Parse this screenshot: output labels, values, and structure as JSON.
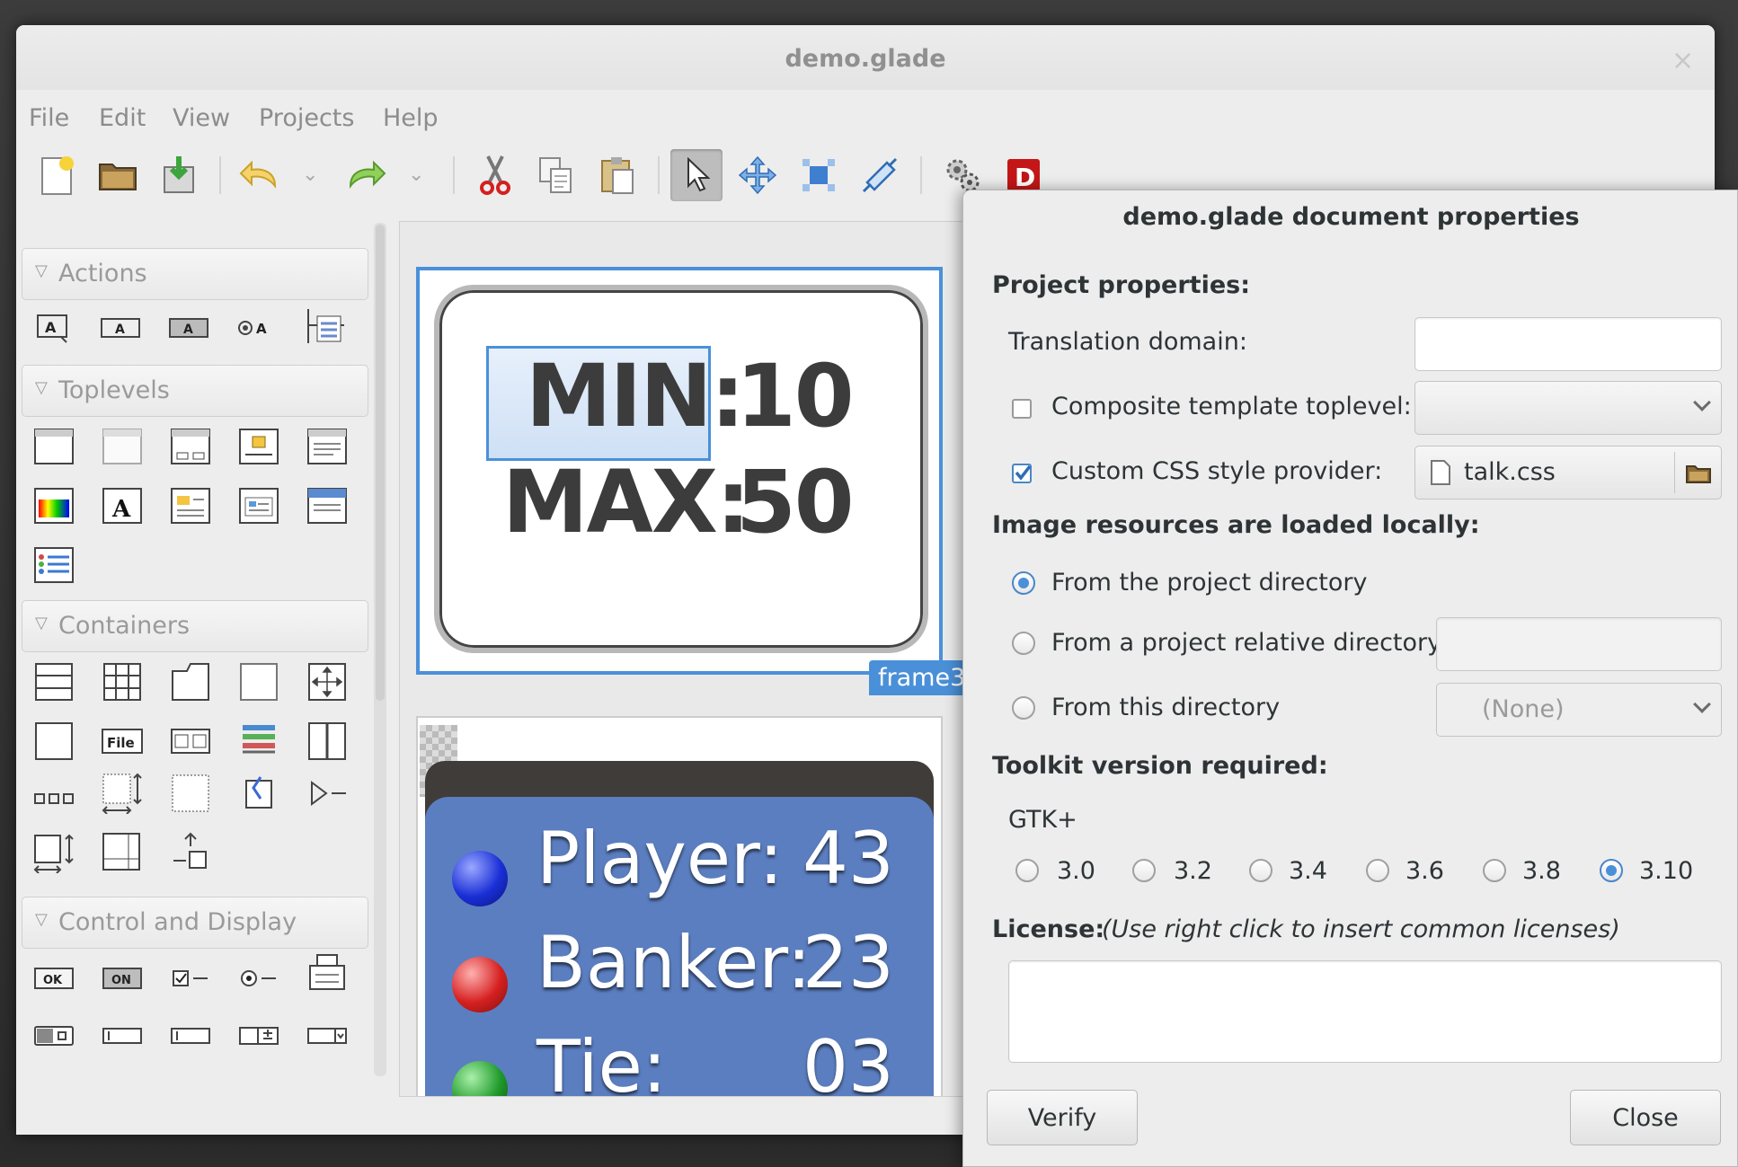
{
  "window": {
    "title": "demo.glade",
    "close_glyph": "×"
  },
  "menubar": [
    "File",
    "Edit",
    "View",
    "Projects",
    "Help"
  ],
  "toolbar": {
    "icons": [
      "new-file-icon",
      "open-folder-icon",
      "save-icon",
      "undo-icon",
      "redo-icon",
      "cut-icon",
      "copy-icon",
      "paste-icon",
      "select-pointer-icon",
      "drag-resize-icon",
      "margin-edit-icon",
      "alignment-edit-icon",
      "preferences-gears-icon",
      "devhelp-icon"
    ]
  },
  "palette": {
    "groups": [
      {
        "label": "Actions"
      },
      {
        "label": "Toplevels"
      },
      {
        "label": "Containers"
      },
      {
        "label": "Control and Display"
      }
    ],
    "glyphs": {
      "ok": "OK",
      "on": "ON",
      "file": "File",
      "a": "A"
    }
  },
  "canvas": {
    "frame3": {
      "min_label": "MIN:",
      "min_value": "10",
      "max_label": "MAX:",
      "max_value": "50",
      "tag": "frame3"
    },
    "scoreboard": [
      {
        "label": "Player:",
        "value": "43",
        "color": "#1a2fd6"
      },
      {
        "label": "Banker:",
        "value": "23",
        "color": "#d62020"
      },
      {
        "label": "Tie:",
        "value": "03",
        "color": "#1f9a2a"
      }
    ]
  },
  "dialog": {
    "title": "demo.glade document properties",
    "project_properties": "Project properties:",
    "translation_domain_label": "Translation domain:",
    "translation_domain_value": "",
    "composite_label": "Composite template toplevel:",
    "composite_checked": false,
    "css_label": "Custom CSS style provider:",
    "css_checked": true,
    "css_file": "talk.css",
    "image_resources_heading": "Image resources are loaded locally:",
    "radio_project_dir": "From the project directory",
    "radio_relative_dir": "From a project relative directory",
    "radio_this_dir": "From this directory",
    "this_dir_value": "(None)",
    "toolkit_heading": "Toolkit version required:",
    "toolkit_name": "GTK+",
    "versions": [
      "3.0",
      "3.2",
      "3.4",
      "3.6",
      "3.8",
      "3.10"
    ],
    "selected_version": "3.10",
    "license_label": "License:",
    "license_hint": "(Use right click to insert common licenses)",
    "verify_button": "Verify",
    "close_button": "Close"
  },
  "colors": {
    "accent": "#4a90d9",
    "board_blue": "#5b7ec0"
  }
}
